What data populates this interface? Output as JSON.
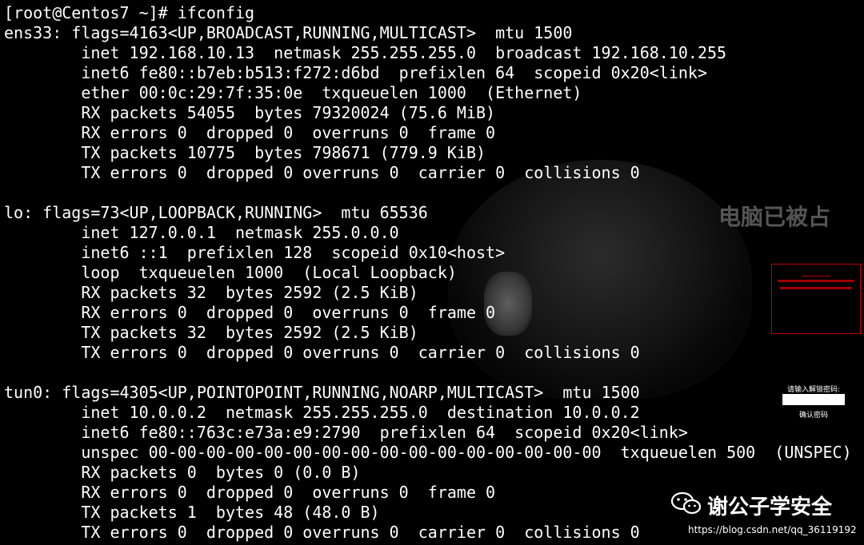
{
  "terminal": {
    "prompt": "[root@Centos7 ~]# ifconfig",
    "lines": [
      "ens33: flags=4163<UP,BROADCAST,RUNNING,MULTICAST>  mtu 1500",
      "        inet 192.168.10.13  netmask 255.255.255.0  broadcast 192.168.10.255",
      "        inet6 fe80::b7eb:b513:f272:d6bd  prefixlen 64  scopeid 0x20<link>",
      "        ether 00:0c:29:7f:35:0e  txqueuelen 1000  (Ethernet)",
      "        RX packets 54055  bytes 79320024 (75.6 MiB)",
      "        RX errors 0  dropped 0  overruns 0  frame 0",
      "        TX packets 10775  bytes 798671 (779.9 KiB)",
      "        TX errors 0  dropped 0 overruns 0  carrier 0  collisions 0",
      "",
      "lo: flags=73<UP,LOOPBACK,RUNNING>  mtu 65536",
      "        inet 127.0.0.1  netmask 255.0.0.0",
      "        inet6 ::1  prefixlen 128  scopeid 0x10<host>",
      "        loop  txqueuelen 1000  (Local Loopback)",
      "        RX packets 32  bytes 2592 (2.5 KiB)",
      "        RX errors 0  dropped 0  overruns 0  frame 0",
      "        TX packets 32  bytes 2592 (2.5 KiB)",
      "        TX errors 0  dropped 0 overruns 0  carrier 0  collisions 0",
      "",
      "tun0: flags=4305<UP,POINTOPOINT,RUNNING,NOARP,MULTICAST>  mtu 1500",
      "        inet 10.0.0.2  netmask 255.255.255.0  destination 10.0.0.2",
      "        inet6 fe80::763c:e73a:e9:2790  prefixlen 64  scopeid 0x20<link>",
      "        unspec 00-00-00-00-00-00-00-00-00-00-00-00-00-00-00-00  txqueuelen 500  (UNSPEC)",
      "        RX packets 0  bytes 0 (0.0 B)",
      "        RX errors 0  dropped 0  overruns 0  frame 0",
      "        TX packets 1  bytes 48 (48.0 B)",
      "        TX errors 0  dropped 0 overruns 0  carrier 0  collisions 0"
    ]
  },
  "overlay": {
    "ransom_title": "电脑已被占",
    "unlock_label": "请输入解锁密码:",
    "unlock_confirm": "确认密码"
  },
  "watermark": {
    "account_name": "谢公子学安全",
    "url": "https://blog.csdn.net/qq_36119192",
    "icon": "wechat-icon"
  },
  "colors": {
    "background": "#000000",
    "text": "#ffffff",
    "alert": "#d00000"
  }
}
